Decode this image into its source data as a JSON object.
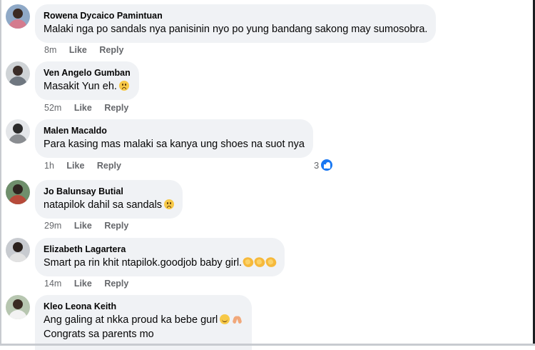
{
  "comments": [
    {
      "author": "Rowena Dycaico Pamintuan",
      "text": "Malaki nga po sandals nya panisinin nyo po yung bandang sakong may sumosobra.",
      "time": "8m",
      "like_label": "Like",
      "reply_label": "Reply",
      "avatar_colors": {
        "bg": "#8fa9c7",
        "head": "#3b2a22",
        "body": "#d47b8e"
      }
    },
    {
      "author": "Ven Angelo Gumban",
      "text": "Masakit Yun eh.",
      "emoji": "sad-face",
      "time": "52m",
      "like_label": "Like",
      "reply_label": "Reply",
      "avatar_colors": {
        "bg": "#cfd3d6",
        "head": "#3a2d28",
        "body": "#6f7780"
      }
    },
    {
      "author": "Malen Macaldo",
      "text": "Para kasing mas malaki sa kanya ung shoes na suot nya",
      "time": "1h",
      "like_label": "Like",
      "reply_label": "Reply",
      "reaction_count": "3",
      "reaction_icon": "like-reaction-icon",
      "avatar_colors": {
        "bg": "#e4e6e9",
        "head": "#2b2b2b",
        "body": "#8a8d91"
      }
    },
    {
      "author": "Jo Balunsay Butial",
      "text": "natapilok dahil sa sandals",
      "emoji": "sad-face",
      "time": "29m",
      "like_label": "Like",
      "reply_label": "Reply",
      "avatar_colors": {
        "bg": "#6f8f6c",
        "head": "#2f2520",
        "body": "#b74a3a"
      }
    },
    {
      "author": "Elizabeth Lagartera",
      "text": "Smart pa rin khit ntapilok.goodjob baby girl.",
      "emoji": "clapping-hands",
      "emoji_count": 3,
      "time": "14m",
      "like_label": "Like",
      "reply_label": "Reply",
      "avatar_colors": {
        "bg": "#c8cbd0",
        "head": "#2a211d",
        "body": "#e2e2e2"
      }
    },
    {
      "author": "Kleo Leona Keith",
      "text": "Ang galing at nkka proud ka bebe gurl",
      "text2": "Congrats sa parents mo",
      "emoji": "smile-and-pray",
      "avatar_colors": {
        "bg": "#b7c6b0",
        "head": "#3a2a22",
        "body": "#f2f2f2"
      }
    }
  ]
}
